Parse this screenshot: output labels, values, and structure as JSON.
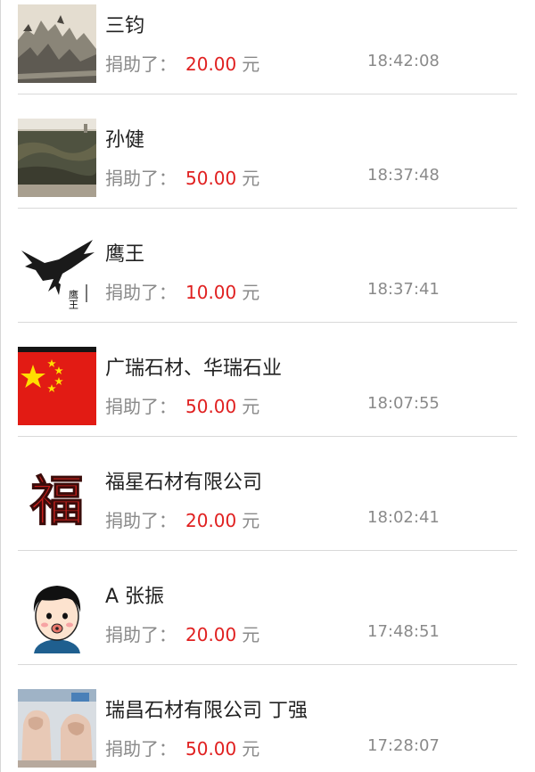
{
  "donations": [
    {
      "name": "三钧",
      "prefix": "捐助了：",
      "amount": "20.00",
      "unit": "元",
      "time": "18:42:08",
      "avatar_icon": "landscape-painting-icon"
    },
    {
      "name": "孙健",
      "prefix": "捐助了：",
      "amount": "50.00",
      "unit": "元",
      "time": "18:37:48",
      "avatar_icon": "stone-slab-icon"
    },
    {
      "name": "鹰王",
      "prefix": "捐助了：",
      "amount": "10.00",
      "unit": "元",
      "time": "18:37:41",
      "avatar_icon": "eagle-ink-icon"
    },
    {
      "name": "广瑞石材、华瑞石业",
      "prefix": "捐助了：",
      "amount": "50.00",
      "unit": "元",
      "time": "18:07:55",
      "avatar_icon": "china-flag-icon"
    },
    {
      "name": "福星石材有限公司",
      "prefix": "捐助了：",
      "amount": "20.00",
      "unit": "元",
      "time": "18:02:41",
      "avatar_icon": "fu-character-icon"
    },
    {
      "name": "A 张振",
      "prefix": "捐助了：",
      "amount": "20.00",
      "unit": "元",
      "time": "17:48:51",
      "avatar_icon": "cartoon-boy-icon"
    },
    {
      "name": "瑞昌石材有限公司 丁强",
      "prefix": "捐助了：",
      "amount": "50.00",
      "unit": "元",
      "time": "17:28:07",
      "avatar_icon": "stone-lion-icon"
    }
  ],
  "avatar_texts": {
    "eagle_caption": "鹰王",
    "fu_character": "福"
  },
  "colors": {
    "amount": "#e02020",
    "label": "#8a8a8a",
    "name": "#222222",
    "divider": "#d9d9d9"
  }
}
